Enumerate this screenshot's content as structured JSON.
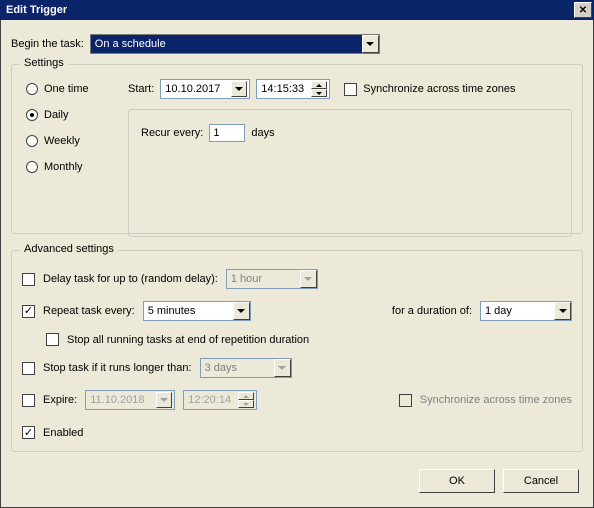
{
  "title": "Edit Trigger",
  "begin_label": "Begin the task:",
  "begin_value": "On a schedule",
  "settings": {
    "legend": "Settings",
    "radios": {
      "one_time": "One time",
      "daily": "Daily",
      "weekly": "Weekly",
      "monthly": "Monthly"
    },
    "start_label": "Start:",
    "date": "10.10.2017",
    "time": "14:15:33",
    "sync_label": "Synchronize across time zones",
    "recur_label": "Recur every:",
    "recur_value": "1",
    "recur_unit": "days"
  },
  "advanced": {
    "legend": "Advanced settings",
    "delay_label": "Delay task for up to (random delay):",
    "delay_value": "1 hour",
    "repeat_label": "Repeat task every:",
    "repeat_value": "5 minutes",
    "duration_label": "for a duration of:",
    "duration_value": "1 day",
    "stop_all_label": "Stop all running tasks at end of repetition duration",
    "stop_if_label": "Stop task if it runs longer than:",
    "stop_if_value": "3 days",
    "expire_label": "Expire:",
    "expire_date": "11.10.2018",
    "expire_time": "12:20:14",
    "expire_sync_label": "Synchronize across time zones",
    "enabled_label": "Enabled"
  },
  "buttons": {
    "ok": "OK",
    "cancel": "Cancel"
  }
}
